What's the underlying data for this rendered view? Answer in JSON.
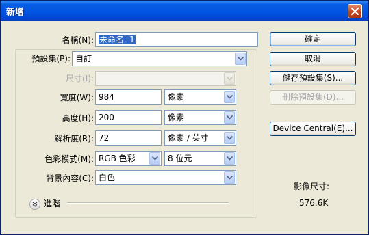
{
  "window": {
    "title": "新增"
  },
  "form": {
    "name_label": "名稱(N):",
    "name_value": "未命名 -1",
    "preset_label": "預設集(P):",
    "preset_value": "自訂",
    "size_label": "尺寸(I):",
    "size_value": "",
    "width_label": "寬度(W):",
    "width_value": "984",
    "width_unit": "像素",
    "height_label": "高度(H):",
    "height_value": "200",
    "height_unit": "像素",
    "resolution_label": "解析度(R):",
    "resolution_value": "72",
    "resolution_unit": "像素 / 英寸",
    "color_mode_label": "色彩模式(M):",
    "color_mode_value": "RGB 色彩",
    "bit_depth_value": "8 位元",
    "background_label": "背景內容(C):",
    "background_value": "白色",
    "advanced_label": "進階"
  },
  "buttons": {
    "ok": "確定",
    "cancel": "取消",
    "save_preset": "儲存預設集(S)...",
    "delete_preset": "刪除預設集(D)...",
    "device_central": "Device Central(E)..."
  },
  "image_size": {
    "label": "影像尺寸:",
    "value": "576.6K"
  },
  "colors": {
    "title_bar": "#0054e3",
    "dialog_bg": "#ece9d8",
    "selection": "#316ac5"
  }
}
